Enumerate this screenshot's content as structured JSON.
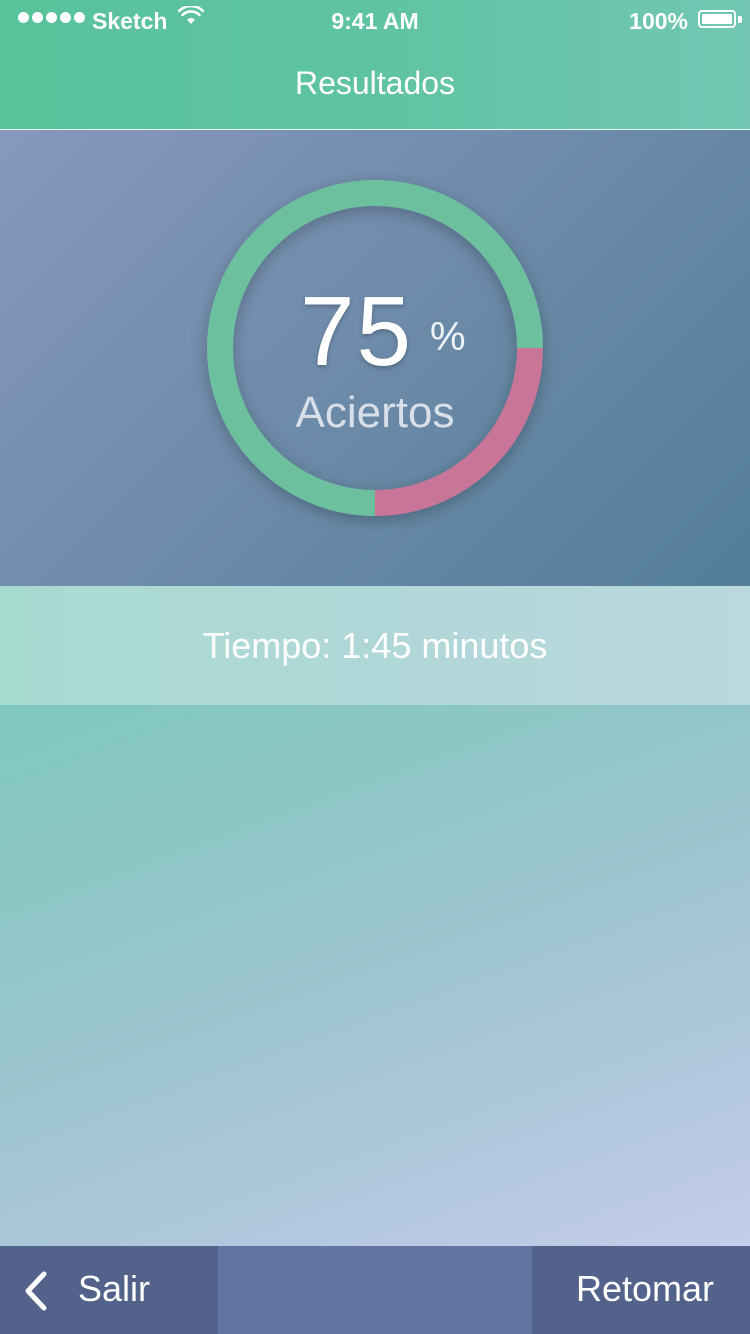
{
  "status_bar": {
    "carrier": "Sketch",
    "time": "9:41 AM",
    "battery": "100%"
  },
  "header": {
    "title": "Resultados"
  },
  "result": {
    "score": "75",
    "unit": "%",
    "label": "Aciertos",
    "correct_fraction": 0.75,
    "colors": {
      "correct": "#6cc09e",
      "incorrect": "#c97598"
    }
  },
  "time": {
    "text": "Tiempo: 1:45 minutos"
  },
  "footer": {
    "exit_label": "Salir",
    "retake_label": "Retomar"
  }
}
